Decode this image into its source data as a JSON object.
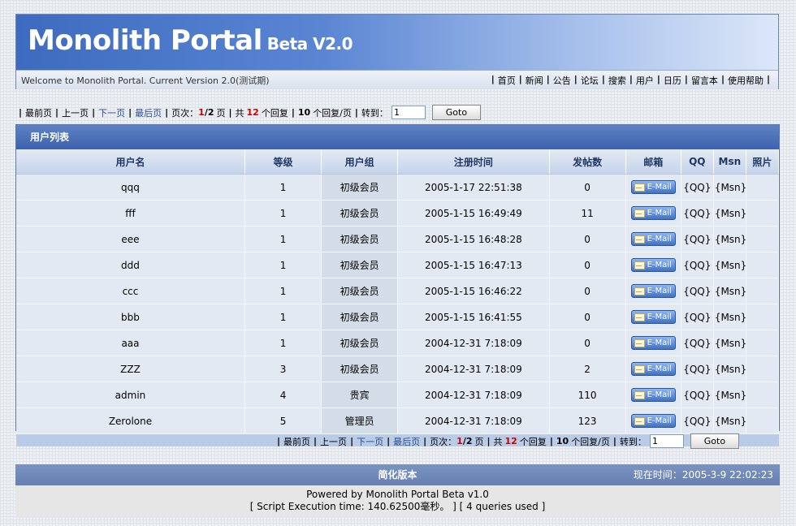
{
  "header": {
    "title": "Monolith Portal",
    "version": "Beta V2.0",
    "welcome": "Welcome to Monolith Portal. Current Version 2.0(测试期)",
    "nav": [
      "首页",
      "新闻",
      "公告",
      "论坛",
      "搜索",
      "用户",
      "日历",
      "留言本",
      "使用帮助"
    ]
  },
  "pager": {
    "first": "最前页",
    "prev": "上一页",
    "next": "下一页",
    "last": "最后页",
    "page_label": "页次：",
    "current_page": "1",
    "total_pages": "2",
    "page_suffix": "页",
    "total_label": "共",
    "total_replies": "12",
    "replies_label": "个回复",
    "per_page": "10",
    "per_page_label": "个回复/页",
    "goto_label": "转到：",
    "goto_value": "1",
    "goto_button": "Goto"
  },
  "panel": {
    "title": "用户列表",
    "columns": [
      "用户名",
      "等级",
      "用户组",
      "注册时间",
      "发帖数",
      "邮箱",
      "QQ",
      "Msn",
      "照片"
    ],
    "rows": [
      {
        "name": "qqq",
        "level": "1",
        "group": "初级会员",
        "registered": "2005-1-17 22:51:38",
        "posts": "0"
      },
      {
        "name": "fff",
        "level": "1",
        "group": "初级会员",
        "registered": "2005-1-15 16:49:49",
        "posts": "11"
      },
      {
        "name": "eee",
        "level": "1",
        "group": "初级会员",
        "registered": "2005-1-15 16:48:28",
        "posts": "0"
      },
      {
        "name": "ddd",
        "level": "1",
        "group": "初级会员",
        "registered": "2005-1-15 16:47:13",
        "posts": "0"
      },
      {
        "name": "ccc",
        "level": "1",
        "group": "初级会员",
        "registered": "2005-1-15 16:46:22",
        "posts": "0"
      },
      {
        "name": "bbb",
        "level": "1",
        "group": "初级会员",
        "registered": "2005-1-15 16:41:55",
        "posts": "0"
      },
      {
        "name": "aaa",
        "level": "1",
        "group": "初级会员",
        "registered": "2004-12-31 7:18:09",
        "posts": "0"
      },
      {
        "name": "ZZZ",
        "level": "3",
        "group": "初级会员",
        "registered": "2004-12-31 7:18:09",
        "posts": "2"
      },
      {
        "name": "admin",
        "level": "4",
        "group": "贵宾",
        "registered": "2004-12-31 7:18:09",
        "posts": "110"
      },
      {
        "name": "Zerolone",
        "level": "5",
        "group": "管理员",
        "registered": "2004-12-31 7:18:09",
        "posts": "123"
      }
    ],
    "email_label": "E-Mail",
    "qq_label": "{QQ}",
    "msn_label": "{Msn}"
  },
  "footer": {
    "simple_version": "简化版本",
    "time_label": "现在时间：",
    "time": "2005-3-9 22:02:23",
    "powered": "Powered by Monolith Portal Beta v1.0",
    "exec": "[ Script Execution time: 140.62500毫秒。 ] [ 4 queries used ]"
  }
}
